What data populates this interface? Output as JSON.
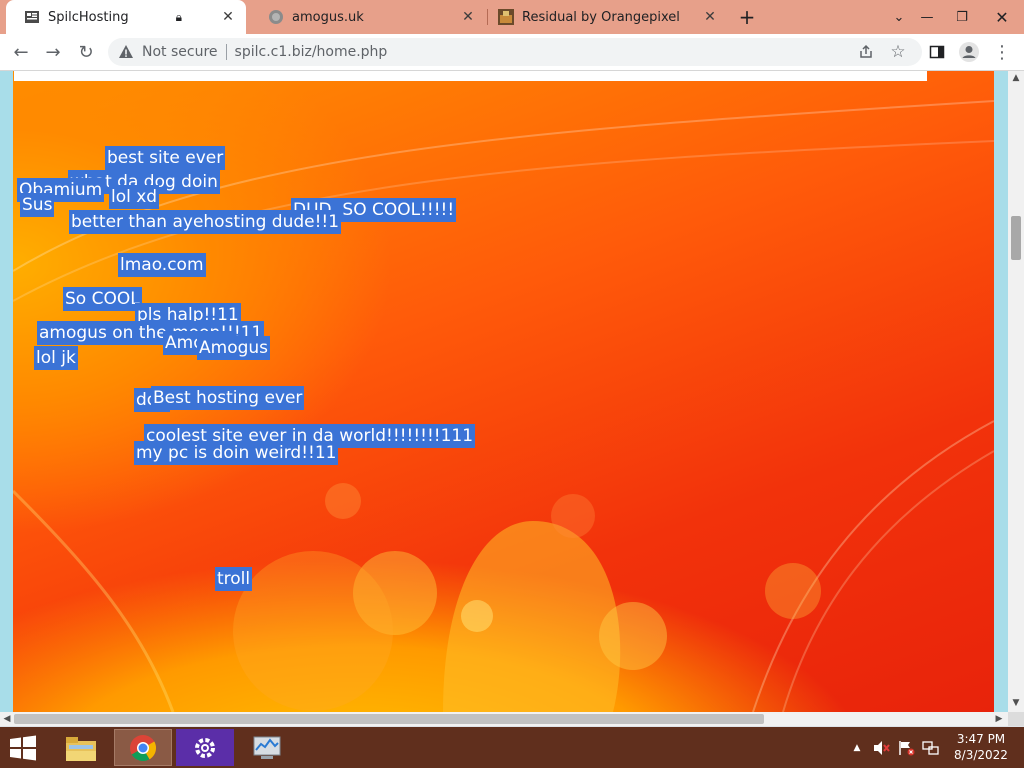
{
  "browser": {
    "tabs": [
      {
        "title": "SpilcHosting",
        "active": true
      },
      {
        "title": "amogus.uk",
        "active": false
      },
      {
        "title": "Residual by Orangepixel",
        "active": false
      }
    ],
    "address": {
      "security": "Not secure",
      "url": "spilc.c1.biz/home.php"
    }
  },
  "page": {
    "notes": [
      "best site ever",
      "what da dog doin",
      "Obamium",
      "lol xd",
      "Sus",
      "DUD, SO COOL!!!!!",
      "better than ayehosting dude!!1",
      "lmao.com",
      "So COOL",
      "pls halp!!11",
      "amogus on the moon!!!11",
      "Amogus",
      "Amogus",
      "lol jk",
      "dog",
      "Best hosting ever",
      "coolest site ever in da world!!!!!!!!111",
      "my pc is doin weird!!11",
      "troll"
    ]
  },
  "taskbar": {
    "time": "3:47 PM",
    "date": "8/3/2022"
  },
  "colors": {
    "tabstrip": "#e7a08a",
    "note_bg": "#3b73d6",
    "taskbar": "#602f1d",
    "page_side": "#a8dde9"
  }
}
